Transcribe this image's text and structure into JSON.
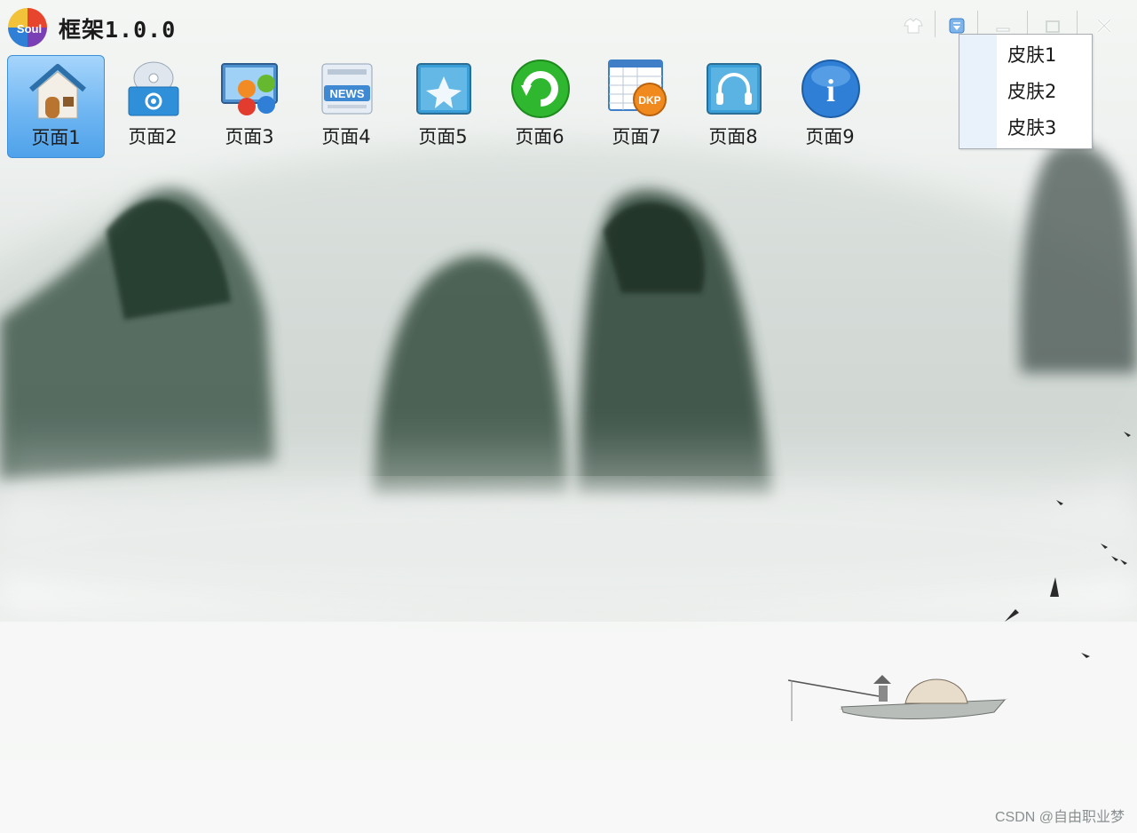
{
  "app": {
    "title": "框架1.0.0",
    "logo_text": "Soul"
  },
  "window_controls": [
    {
      "name": "skin-icon"
    },
    {
      "name": "dropdown-icon"
    },
    {
      "name": "minimize-icon"
    },
    {
      "name": "maximize-icon"
    },
    {
      "name": "close-icon"
    }
  ],
  "nav": {
    "items": [
      {
        "label": "页面1",
        "icon": "home-icon",
        "active": true
      },
      {
        "label": "页面2",
        "icon": "disc-settings-icon"
      },
      {
        "label": "页面3",
        "icon": "apps-monitor-icon"
      },
      {
        "label": "页面4",
        "icon": "news-icon",
        "icon_text": "NEWS"
      },
      {
        "label": "页面5",
        "icon": "star-shield-icon"
      },
      {
        "label": "页面6",
        "icon": "green-refresh-icon"
      },
      {
        "label": "页面7",
        "icon": "spreadsheet-icon",
        "icon_text": "DKP"
      },
      {
        "label": "页面8",
        "icon": "headphones-icon"
      },
      {
        "label": "页面9",
        "icon": "info-icon",
        "icon_text": "i"
      }
    ]
  },
  "skin_menu": {
    "items": [
      "皮肤1",
      "皮肤2",
      "皮肤3"
    ]
  },
  "watermark": "CSDN @自由职业梦",
  "colors": {
    "active_nav": "#6fb6f2",
    "menu_gutter": "#e9f1fb",
    "title_text": "#1b1b1b"
  }
}
